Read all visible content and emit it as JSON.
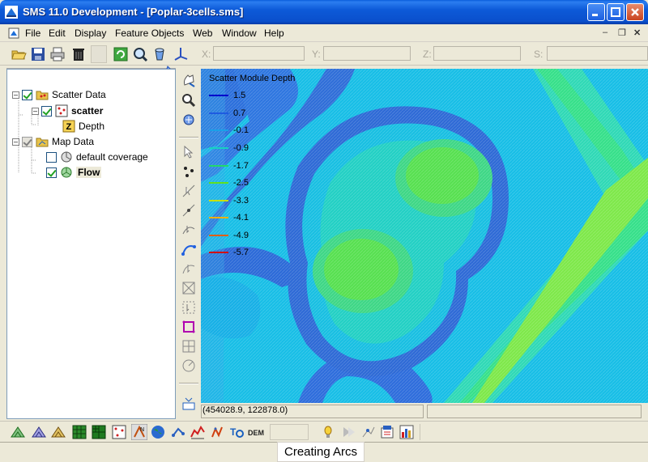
{
  "window": {
    "title": "SMS 11.0 Development - [Poplar-3cells.sms]"
  },
  "menu": {
    "items": [
      "File",
      "Edit",
      "Display",
      "Feature Objects",
      "Web",
      "Window",
      "Help"
    ]
  },
  "toolbar": {
    "buttons": [
      "open-icon",
      "save-icon",
      "print-icon",
      "trash-icon",
      "refresh-icon",
      "zoom-icon",
      "bucket-icon",
      "axes-icon"
    ],
    "coords": [
      {
        "label": "X:"
      },
      {
        "label": "Y:"
      },
      {
        "label": "Z:"
      },
      {
        "label": "S:"
      }
    ]
  },
  "tree": [
    {
      "label": "Scatter Data",
      "icon": "scatter-folder-icon",
      "checked": true
    },
    {
      "label": "scatter",
      "icon": "scatter-set-icon",
      "checked": true
    },
    {
      "label": "Depth",
      "icon": "dataset-z-icon"
    },
    {
      "label": "Map Data",
      "icon": "map-folder-icon",
      "checked": true
    },
    {
      "label": "default coverage",
      "icon": "coverage-icon",
      "checked": false
    },
    {
      "label": "Flow",
      "icon": "flow-coverage-icon",
      "checked": true
    }
  ],
  "legend": {
    "title": "Scatter Module Depth",
    "entries": [
      {
        "value": "1.5",
        "color": "#0000cc"
      },
      {
        "value": "0.7",
        "color": "#1e5be0"
      },
      {
        "value": "-0.1",
        "color": "#1aa0e8"
      },
      {
        "value": "-0.9",
        "color": "#18d0c0"
      },
      {
        "value": "-1.7",
        "color": "#22d86a"
      },
      {
        "value": "-2.5",
        "color": "#60e020"
      },
      {
        "value": "-3.3",
        "color": "#c8e000"
      },
      {
        "value": "-4.1",
        "color": "#f0b000"
      },
      {
        "value": "-4.9",
        "color": "#e06010"
      },
      {
        "value": "-5.7",
        "color": "#d01010"
      }
    ]
  },
  "coordinate_readout": "(454028.9, 122878.0)",
  "status": {
    "message": "Creating Arcs"
  },
  "colors": {
    "titlebar": "#0a5ddc",
    "canvas_base": "#3b7bdc",
    "highlight": "#00c8e0"
  }
}
